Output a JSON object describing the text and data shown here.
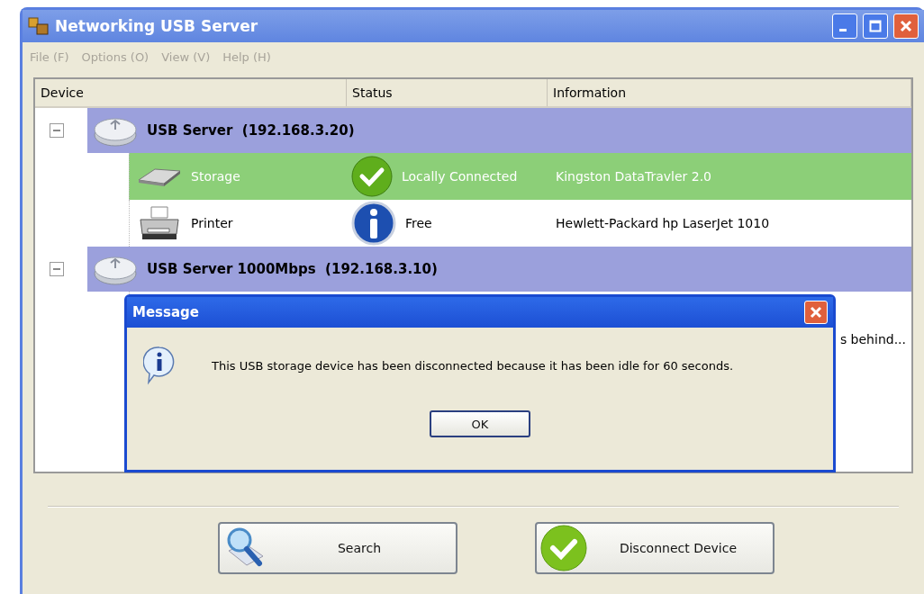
{
  "window": {
    "title": "Networking USB Server"
  },
  "menu": [
    {
      "label": "File (F)",
      "disabled": true
    },
    {
      "label": "Options (O)",
      "disabled": true
    },
    {
      "label": "View (V)",
      "disabled": true
    },
    {
      "label": "Help (H)",
      "disabled": true
    }
  ],
  "table": {
    "columns": [
      "Device",
      "Status",
      "Information"
    ],
    "servers": [
      {
        "name": "USB Server  (192.168.3.20)",
        "expanded": true,
        "devices": [
          {
            "kind": "storage",
            "name": "Storage",
            "status": {
              "kind": "connected",
              "text": "Locally Connected"
            },
            "information": "Kingston DataTravler 2.0",
            "selected": true
          },
          {
            "kind": "printer",
            "name": "Printer",
            "status": {
              "kind": "free",
              "text": "Free"
            },
            "information": "Hewlett-Packard hp LaserJet 1010",
            "selected": false
          }
        ]
      },
      {
        "name": "USB Server 1000Mbps  (192.168.3.10)",
        "expanded": true,
        "devices": [
          {
            "kind": "covered",
            "selected": false
          },
          {
            "kind": "covered",
            "information": "s behind...",
            "selected": false
          }
        ]
      }
    ]
  },
  "dialog": {
    "title": "Message",
    "text": "This USB storage device has been disconnected because it has been idle for 60 seconds.",
    "button": "OK"
  },
  "buttons": [
    {
      "kind": "search",
      "label": "Search"
    },
    {
      "kind": "check",
      "label": "Disconnect Device"
    }
  ]
}
